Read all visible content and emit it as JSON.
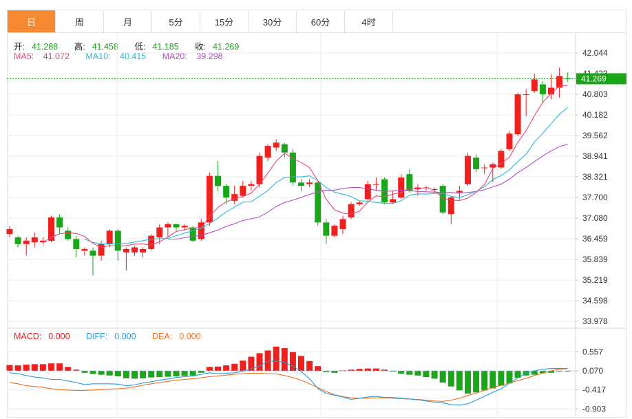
{
  "tabs": [
    "日",
    "周",
    "月",
    "5分",
    "15分",
    "30分",
    "60分",
    "4时"
  ],
  "active_tab": 0,
  "ohlc": {
    "open_label": "开:",
    "open": "41.288",
    "high_label": "高:",
    "high": "41.458",
    "low_label": "低:",
    "low": "41.185",
    "close_label": "收:",
    "close": "41.269"
  },
  "ma": {
    "ma5_label": "MA5:",
    "ma5": "41.072",
    "ma10_label": "MA10:",
    "ma10": "40.415",
    "ma20_label": "MA20:",
    "ma20": "39.298"
  },
  "macd_info": {
    "macd_label": "MACD:",
    "macd": "0.000",
    "diff_label": "DIFF:",
    "diff": "0.000",
    "dea_label": "DEA:",
    "dea": "0.000"
  },
  "colors": {
    "up": "#f0201e",
    "down": "#1aa51a",
    "ma5": "#e8467a",
    "ma10": "#2bbbd8",
    "ma20": "#b44bc4",
    "diff": "#2a9ad8",
    "dea": "#f07020",
    "price_tag": "#1aa51a",
    "active_tab": "#f58a33"
  },
  "chart_data": {
    "type": "candlestick",
    "price_axis_ticks": [
      "42.044",
      "41.423",
      "40.803",
      "40.182",
      "39.562",
      "38.941",
      "38.321",
      "37.700",
      "37.080",
      "36.459",
      "35.839",
      "35.219",
      "34.598",
      "33.978"
    ],
    "ylim": [
      33.978,
      42.044
    ],
    "current_price": "41.269",
    "candles": [
      [
        36.6,
        36.75,
        36.5,
        36.85
      ],
      [
        36.5,
        36.3,
        36.2,
        36.55
      ],
      [
        36.3,
        36.4,
        35.95,
        36.5
      ],
      [
        36.35,
        36.5,
        36.2,
        36.65
      ],
      [
        36.35,
        36.4,
        36.3,
        36.5
      ],
      [
        36.4,
        37.1,
        36.35,
        37.15
      ],
      [
        37.1,
        36.8,
        36.6,
        37.2
      ],
      [
        36.7,
        36.45,
        36.4,
        36.8
      ],
      [
        36.45,
        36.15,
        35.9,
        36.55
      ],
      [
        36.1,
        36.15,
        35.95,
        36.2
      ],
      [
        36.1,
        35.95,
        35.35,
        36.2
      ],
      [
        35.95,
        36.3,
        35.8,
        36.4
      ],
      [
        36.3,
        36.7,
        36.2,
        36.75
      ],
      [
        36.7,
        36.1,
        35.8,
        36.75
      ],
      [
        36.05,
        36.15,
        35.5,
        36.2
      ],
      [
        36.05,
        36.2,
        35.95,
        36.25
      ],
      [
        36.05,
        36.15,
        35.9,
        36.2
      ],
      [
        36.15,
        36.55,
        36.1,
        36.6
      ],
      [
        36.5,
        36.8,
        36.3,
        36.9
      ],
      [
        36.8,
        36.9,
        36.5,
        36.95
      ],
      [
        36.9,
        36.8,
        36.7,
        36.9
      ],
      [
        36.8,
        36.85,
        36.7,
        36.9
      ],
      [
        36.8,
        36.4,
        36.35,
        36.85
      ],
      [
        36.45,
        36.95,
        36.4,
        37.05
      ],
      [
        36.95,
        38.35,
        36.85,
        38.45
      ],
      [
        38.35,
        38.05,
        37.9,
        38.8
      ],
      [
        38.05,
        37.7,
        37.5,
        38.1
      ],
      [
        37.6,
        37.8,
        37.5,
        38.05
      ],
      [
        37.75,
        38.05,
        37.7,
        38.2
      ],
      [
        38.05,
        38.1,
        37.9,
        38.2
      ],
      [
        38.1,
        38.95,
        38.0,
        39.05
      ],
      [
        38.9,
        39.25,
        38.8,
        39.3
      ],
      [
        39.2,
        39.35,
        39.1,
        39.45
      ],
      [
        39.3,
        39.05,
        38.9,
        39.35
      ],
      [
        39.05,
        38.15,
        38.05,
        39.15
      ],
      [
        38.15,
        38.05,
        37.9,
        38.25
      ],
      [
        38.1,
        38.15,
        38.0,
        38.25
      ],
      [
        38.15,
        36.95,
        36.85,
        38.2
      ],
      [
        36.95,
        36.55,
        36.3,
        37.05
      ],
      [
        36.55,
        36.85,
        36.5,
        36.9
      ],
      [
        36.75,
        37.05,
        36.6,
        37.15
      ],
      [
        37.1,
        37.5,
        37.05,
        37.55
      ],
      [
        37.5,
        37.55,
        37.45,
        37.6
      ],
      [
        37.65,
        38.1,
        37.6,
        38.2
      ],
      [
        38.1,
        38.1,
        37.9,
        38.3
      ],
      [
        38.25,
        37.55,
        37.5,
        38.3
      ],
      [
        37.55,
        37.65,
        37.5,
        37.9
      ],
      [
        37.7,
        38.3,
        37.65,
        38.4
      ],
      [
        38.4,
        37.9,
        37.85,
        38.55
      ],
      [
        37.95,
        38.0,
        37.75,
        38.1
      ],
      [
        38.0,
        38.0,
        37.9,
        38.05
      ],
      [
        37.95,
        37.95,
        37.85,
        38.0
      ],
      [
        38.05,
        37.25,
        37.2,
        38.1
      ],
      [
        37.2,
        37.7,
        36.9,
        37.75
      ],
      [
        37.85,
        37.9,
        37.65,
        38.05
      ],
      [
        38.1,
        38.95,
        38.05,
        39.05
      ],
      [
        38.9,
        38.55,
        38.45,
        39.0
      ],
      [
        38.6,
        38.6,
        38.4,
        38.7
      ],
      [
        38.6,
        38.7,
        38.15,
        38.75
      ],
      [
        38.6,
        39.1,
        38.55,
        39.15
      ],
      [
        39.15,
        39.62,
        39.1,
        39.7
      ],
      [
        39.6,
        40.8,
        39.55,
        40.85
      ],
      [
        40.8,
        40.8,
        40.15,
        40.95
      ],
      [
        40.9,
        41.25,
        40.85,
        41.42
      ],
      [
        41.1,
        40.8,
        40.55,
        41.2
      ],
      [
        40.8,
        41.0,
        40.65,
        41.4
      ],
      [
        41.0,
        41.35,
        40.7,
        41.6
      ],
      [
        41.288,
        41.269,
        41.185,
        41.458
      ]
    ],
    "ma5": [
      null,
      null,
      null,
      null,
      36.35,
      36.5,
      36.61,
      36.64,
      36.62,
      36.53,
      36.32,
      36.2,
      36.25,
      36.24,
      36.25,
      36.3,
      36.3,
      36.27,
      36.37,
      36.51,
      36.68,
      36.73,
      36.79,
      36.79,
      37.13,
      37.4,
      37.57,
      37.67,
      37.73,
      37.83,
      38.1,
      38.43,
      38.79,
      39.03,
      38.88,
      38.75,
      38.6,
      38.2,
      37.65,
      37.33,
      37.23,
      37.2,
      37.29,
      37.56,
      37.75,
      37.72,
      37.8,
      37.85,
      37.98,
      37.95,
      38.0,
      37.91,
      37.68,
      37.62,
      37.61,
      37.68,
      37.85,
      38.09,
      38.57,
      38.72,
      38.91,
      39.36,
      39.71,
      40.16,
      40.56,
      40.83,
      41.05,
      41.07
    ],
    "ma10": [
      null,
      null,
      null,
      null,
      null,
      null,
      null,
      null,
      null,
      36.45,
      36.35,
      36.3,
      36.3,
      36.32,
      36.32,
      36.36,
      36.4,
      36.45,
      36.46,
      36.47,
      36.55,
      36.63,
      36.7,
      36.77,
      36.92,
      37.08,
      37.27,
      37.41,
      37.56,
      37.57,
      37.74,
      37.91,
      38.15,
      38.3,
      38.32,
      38.32,
      38.35,
      38.21,
      38.0,
      37.86,
      37.8,
      37.73,
      37.6,
      37.59,
      37.55,
      37.52,
      37.52,
      37.6,
      37.77,
      37.81,
      37.8,
      37.82,
      37.82,
      37.74,
      37.7,
      37.78,
      37.88,
      38.02,
      38.24,
      38.36,
      38.53,
      38.78,
      39.0,
      39.37,
      39.63,
      39.92,
      40.2,
      40.41
    ],
    "ma20": [
      null,
      null,
      null,
      null,
      null,
      null,
      null,
      null,
      null,
      null,
      null,
      null,
      null,
      null,
      null,
      null,
      null,
      null,
      null,
      36.45,
      36.45,
      36.49,
      36.53,
      36.56,
      36.64,
      36.72,
      36.83,
      36.91,
      37.01,
      37.06,
      37.12,
      37.26,
      37.43,
      37.55,
      37.62,
      37.7,
      37.79,
      37.87,
      37.92,
      37.92,
      37.97,
      38.0,
      38.0,
      37.96,
      37.92,
      37.88,
      37.9,
      37.92,
      37.91,
      37.88,
      37.87,
      37.86,
      37.85,
      37.85,
      37.83,
      37.85,
      37.88,
      37.93,
      38.02,
      38.1,
      38.25,
      38.45,
      38.6,
      38.78,
      38.95,
      39.1,
      39.23,
      39.3
    ],
    "macd_axis_ticks": [
      "0.557",
      "0.070",
      "-0.417",
      "-0.903"
    ],
    "macd_ylim": [
      -0.95,
      0.65
    ],
    "macd_hist": [
      0.15,
      0.14,
      0.16,
      0.17,
      0.17,
      0.19,
      0.19,
      0.1,
      0.03,
      -0.05,
      -0.08,
      -0.1,
      -0.12,
      -0.14,
      -0.19,
      -0.2,
      -0.19,
      -0.17,
      -0.16,
      -0.15,
      -0.14,
      -0.13,
      -0.12,
      -0.05,
      0.1,
      0.11,
      0.14,
      0.18,
      0.26,
      0.36,
      0.45,
      0.52,
      0.62,
      0.58,
      0.48,
      0.38,
      0.25,
      0.12,
      -0.03,
      -0.05,
      0.01,
      0.03,
      0.05,
      0.06,
      0.06,
      0.03,
      -0.02,
      -0.07,
      -0.1,
      -0.12,
      -0.16,
      -0.2,
      -0.3,
      -0.4,
      -0.5,
      -0.58,
      -0.55,
      -0.5,
      -0.45,
      -0.38,
      -0.32,
      -0.18,
      -0.12,
      -0.1,
      -0.06,
      -0.05,
      -0.02,
      0.0
    ],
    "diff": [
      -0.05,
      -0.07,
      -0.12,
      -0.16,
      -0.18,
      -0.22,
      -0.22,
      -0.26,
      -0.3,
      -0.35,
      -0.33,
      -0.33,
      -0.33,
      -0.34,
      -0.38,
      -0.36,
      -0.31,
      -0.28,
      -0.24,
      -0.21,
      -0.17,
      -0.15,
      -0.13,
      -0.09,
      -0.05,
      -0.07,
      -0.06,
      -0.05,
      -0.01,
      0.05,
      0.12,
      0.24,
      0.25,
      0.22,
      0.12,
      -0.02,
      -0.2,
      -0.45,
      -0.58,
      -0.62,
      -0.67,
      -0.73,
      -0.7,
      -0.67,
      -0.65,
      -0.68,
      -0.68,
      -0.7,
      -0.72,
      -0.74,
      -0.77,
      -0.8,
      -0.82,
      -0.86,
      -0.88,
      -0.84,
      -0.75,
      -0.65,
      -0.55,
      -0.46,
      -0.32,
      -0.18,
      -0.06,
      0.0,
      0.04,
      0.06,
      0.06,
      0.06
    ],
    "dea": [
      -0.3,
      -0.33,
      -0.38,
      -0.4,
      -0.42,
      -0.46,
      -0.48,
      -0.49,
      -0.5,
      -0.5,
      -0.49,
      -0.48,
      -0.47,
      -0.46,
      -0.44,
      -0.41,
      -0.37,
      -0.33,
      -0.3,
      -0.27,
      -0.24,
      -0.22,
      -0.2,
      -0.18,
      -0.15,
      -0.13,
      -0.11,
      -0.09,
      -0.07,
      -0.06,
      -0.06,
      -0.07,
      -0.08,
      -0.12,
      -0.17,
      -0.24,
      -0.33,
      -0.43,
      -0.53,
      -0.61,
      -0.66,
      -0.69,
      -0.7,
      -0.7,
      -0.69,
      -0.69,
      -0.7,
      -0.71,
      -0.72,
      -0.73,
      -0.75,
      -0.77,
      -0.78,
      -0.75,
      -0.7,
      -0.63,
      -0.57,
      -0.5,
      -0.43,
      -0.37,
      -0.31,
      -0.25,
      -0.19,
      -0.12,
      -0.06,
      0.0,
      0.04,
      0.06
    ]
  }
}
